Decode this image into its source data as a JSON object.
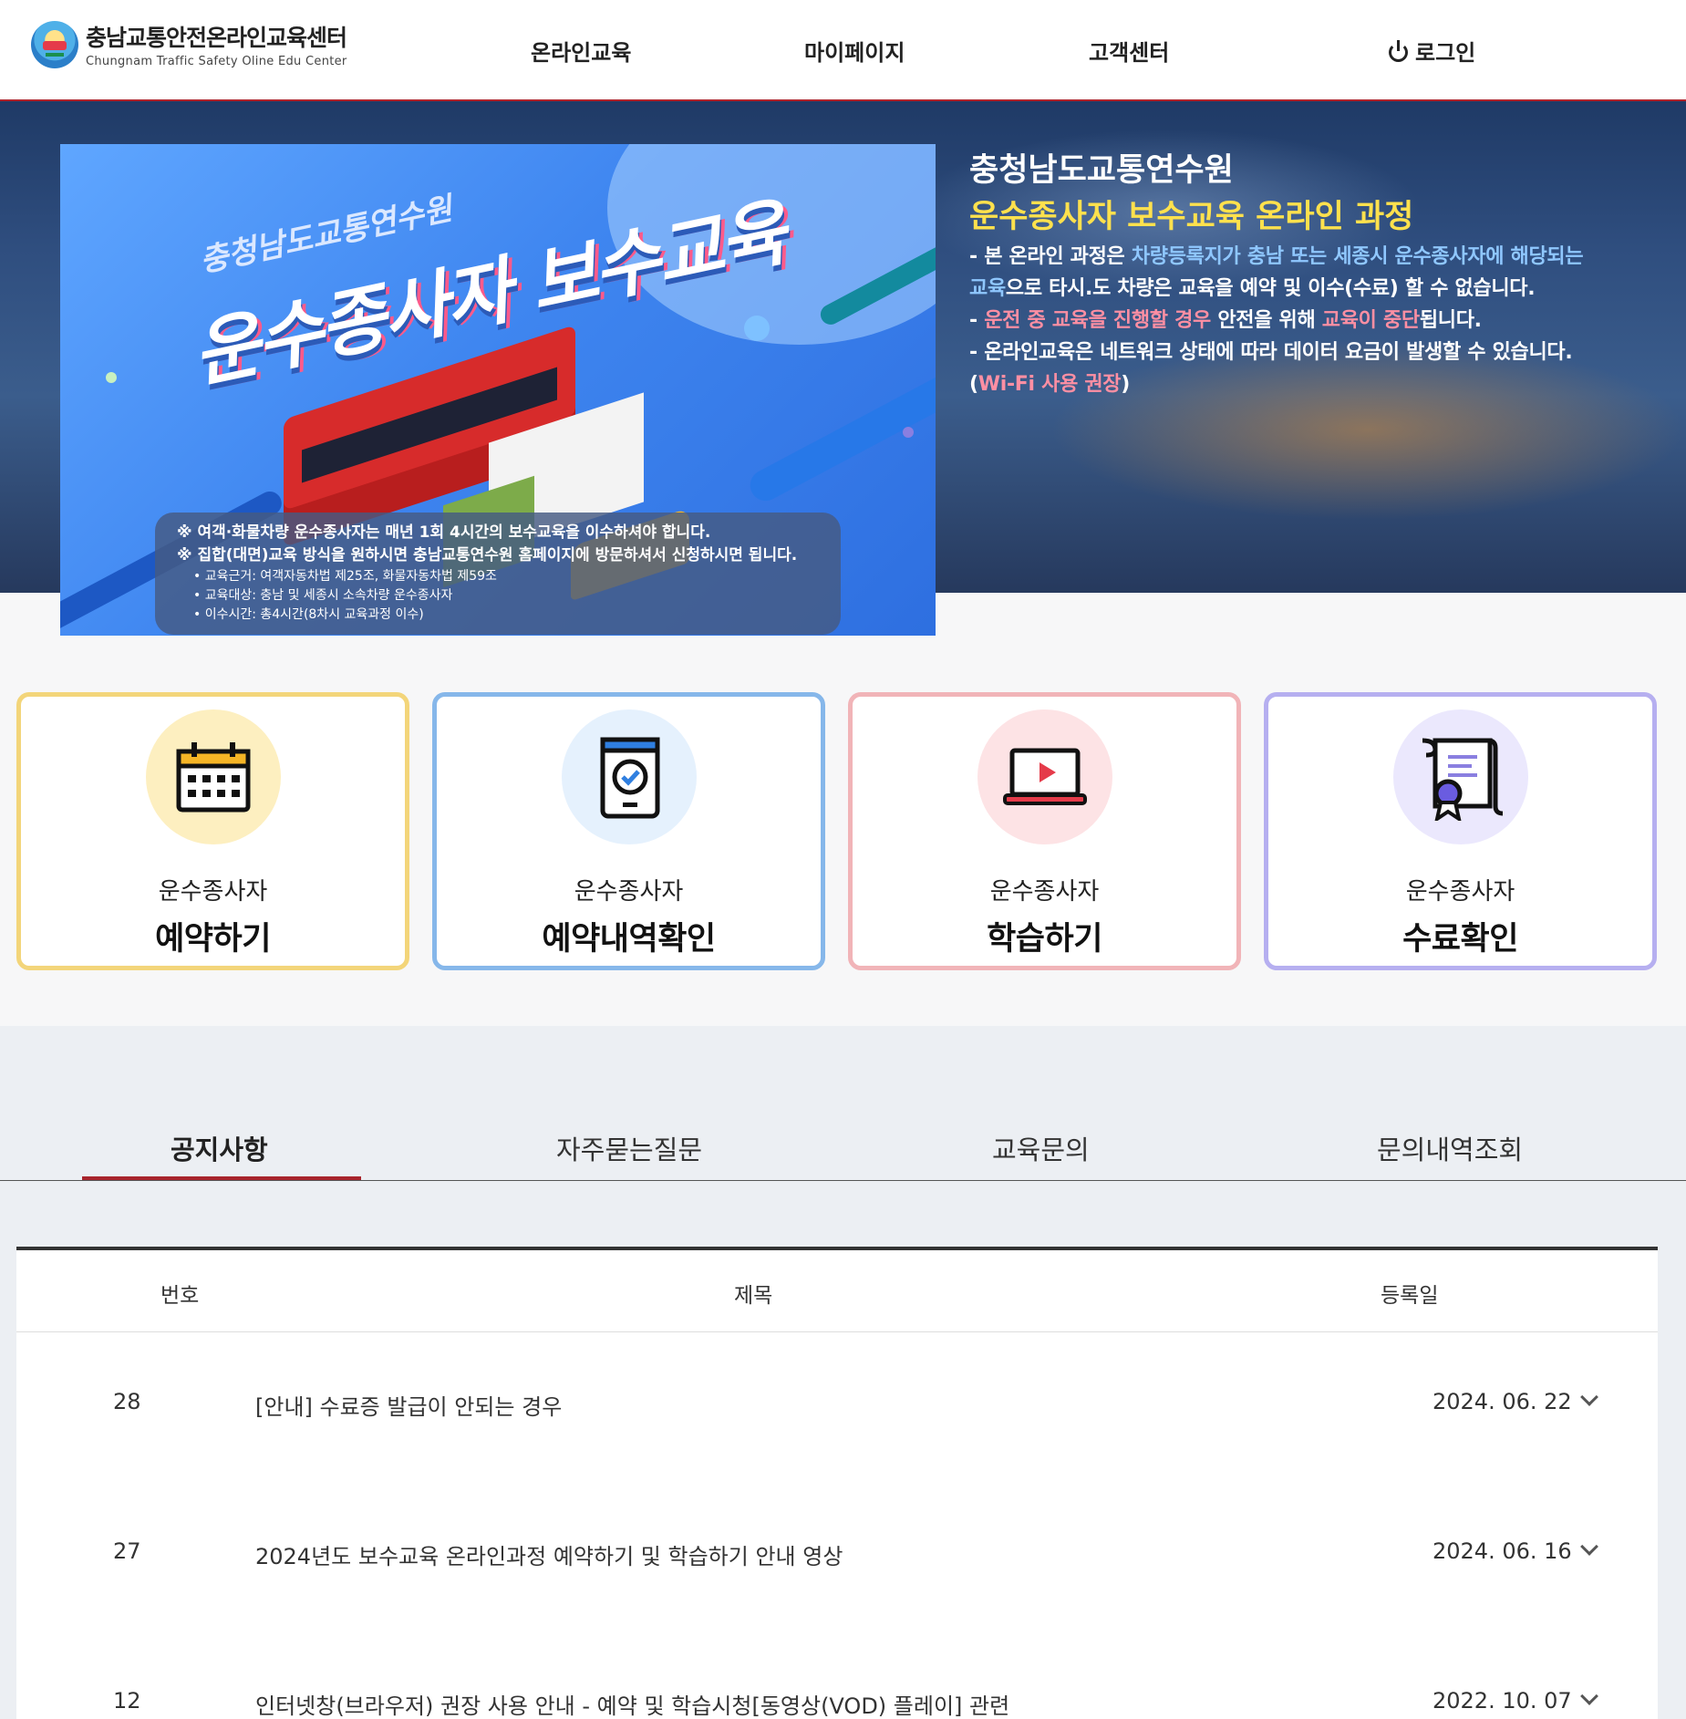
{
  "header": {
    "logo_title": "충남교통안전온라인교육센터",
    "logo_subtitle": "Chungnam Traffic Safety Oline Edu Center",
    "nav": [
      "온라인교육",
      "마이페이지",
      "고객센터"
    ],
    "login": "로그인"
  },
  "banner": {
    "sub_title": "충청남도교통연수원",
    "title": "운수종사자 보수교육",
    "notice_1": "※ 여객·화물차량 운수종사자는 매년 1회 4시간의 보수교육을 이수하셔야 합니다.",
    "notice_2": "※ 집합(대면)교육 방식을 원하시면 충남교통연수원 홈페이지에 방문하셔서 신청하시면 됩니다.",
    "detail_1": "• 교육근거: 여객자동차법 제25조, 화물자동차법 제59조",
    "detail_2": "• 교육대상: 충남 및 세종시 소속차량 운수종사자",
    "detail_3": "• 이수시간: 총4시간(8차시 교육과정 이수)"
  },
  "hero": {
    "org": "충청남도교통연수원",
    "course": "운수종사자 보수교육 온라인 과정",
    "desc1_a": "- 본 온라인 과정은 ",
    "desc1_b": "차량등록지가 충남 또는 세종시 운수종사자에 해당되는 교육",
    "desc1_c": "으로 타시.도 차량은 교육을 예약 및 이수(수료) 할 수 없습니다.",
    "desc2_a": "- ",
    "desc2_b": "운전 중 교육을 진행할 경우",
    "desc2_c": " 안전을 위해 ",
    "desc2_d": "교육이 중단",
    "desc2_e": "됩니다.",
    "desc3_a": "- 온라인교육은 네트워크 상태에 따라 데이터 요금이 발생할 수 있습니다.(",
    "desc3_b": "Wi-Fi 사용 권장",
    "desc3_c": ")"
  },
  "cards": [
    {
      "sub": "운수종사자",
      "main": "예약하기",
      "border": "#f3d57a",
      "bg": "#fdefc0",
      "icon": "calendar-icon"
    },
    {
      "sub": "운수종사자",
      "main": "예약내역확인",
      "border": "#86b7ea",
      "bg": "#e5f1fd",
      "icon": "tablet-check-icon"
    },
    {
      "sub": "운수종사자",
      "main": "학습하기",
      "border": "#f1b4b8",
      "bg": "#fde3e5",
      "icon": "laptop-play-icon"
    },
    {
      "sub": "운수종사자",
      "main": "수료확인",
      "border": "#b6aff0",
      "bg": "#ebe8fd",
      "icon": "certificate-icon"
    }
  ],
  "tabs": [
    "공지사항",
    "자주묻는질문",
    "교육문의",
    "문의내역조회"
  ],
  "table": {
    "headers": {
      "no": "번호",
      "title": "제목",
      "date": "등록일"
    },
    "rows": [
      {
        "no": "28",
        "title": "[안내] 수료증 발급이 안되는 경우",
        "date": "2024. 06. 22"
      },
      {
        "no": "27",
        "title": "2024년도 보수교육 온라인과정 예약하기 및 학습하기 안내 영상",
        "date": "2024. 06. 16"
      },
      {
        "no": "12",
        "title": "인터넷창(브라우저) 권장 사용 안내 - 예약 및 학습시청[동영상(VOD) 플레이] 관련",
        "date": "2022. 10. 07"
      }
    ]
  },
  "colors": {
    "accent": "#a8242c",
    "highlight_yellow": "#ffe14d",
    "highlight_blue": "#8fc7ff",
    "highlight_pink": "#ff8fa3"
  }
}
